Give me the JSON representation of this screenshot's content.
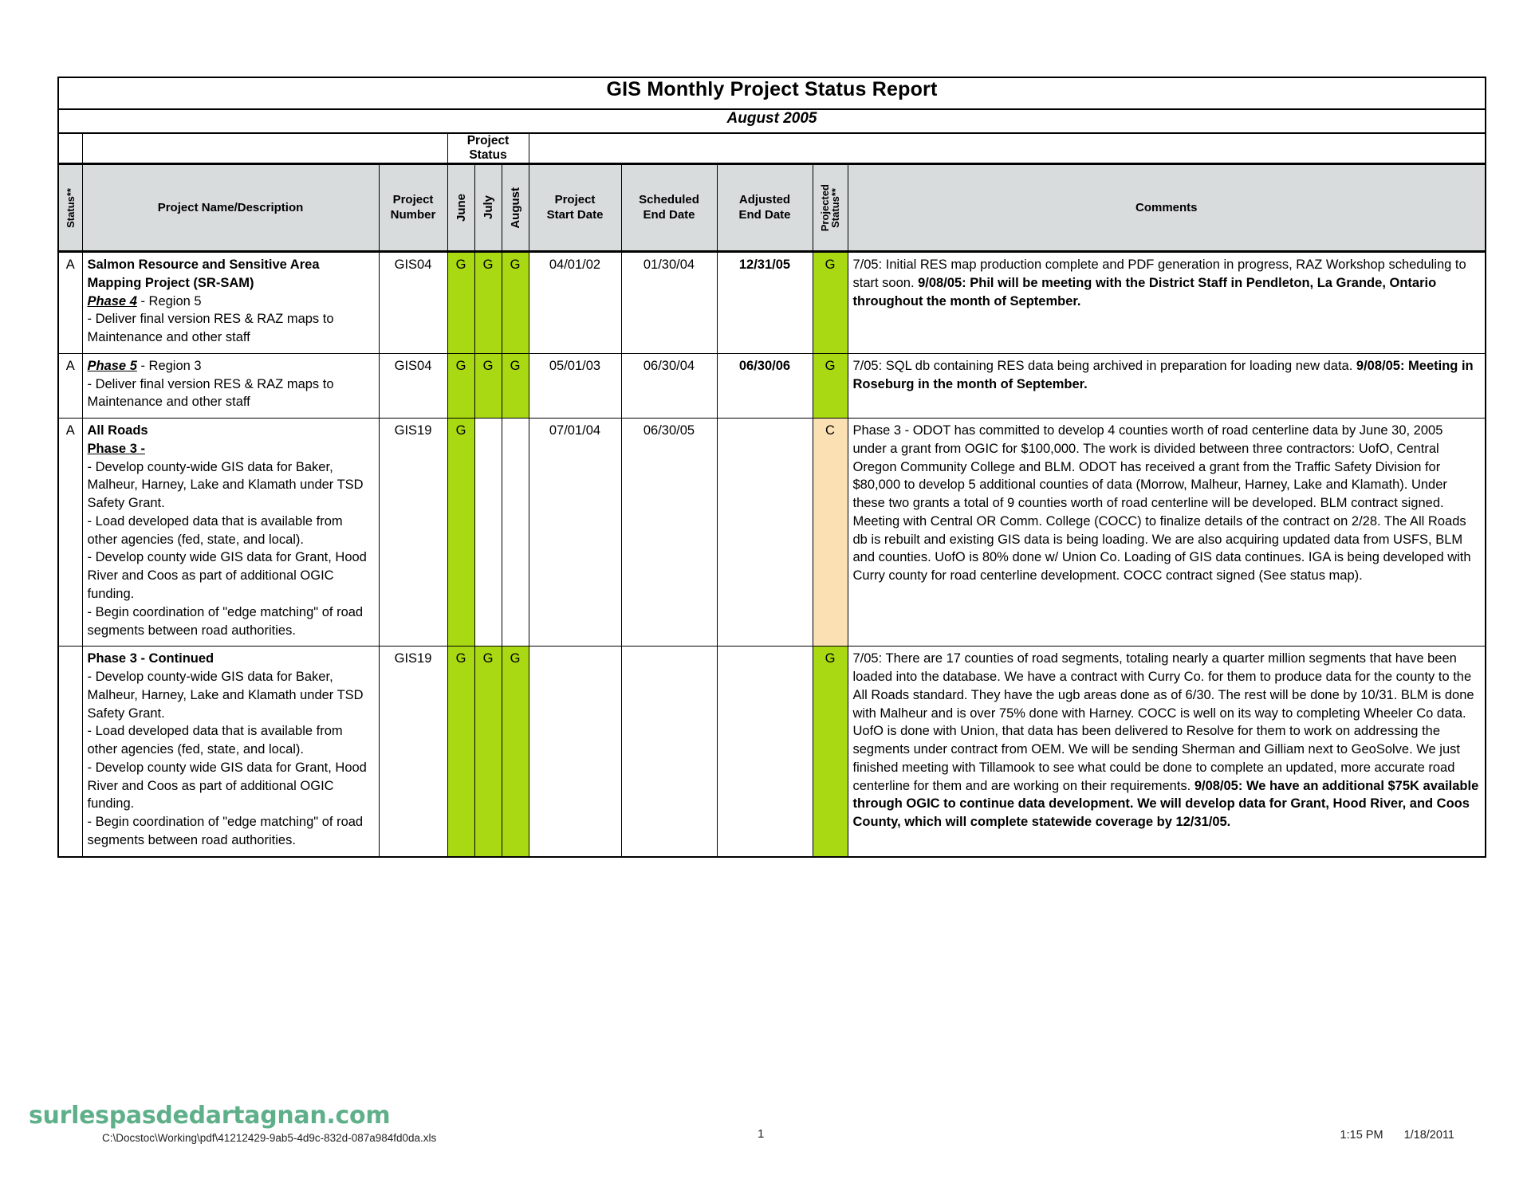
{
  "report": {
    "title": "GIS Monthly Project Status Report",
    "subtitle": "August 2005",
    "group_header": "Project Status",
    "columns": {
      "status": "Status**",
      "project_name": "Project Name/Description",
      "project_number_line1": "Project",
      "project_number_line2": "Number",
      "month1": "June",
      "month2": "July",
      "month3": "August",
      "start_line1": "Project",
      "start_line2": "Start Date",
      "scheduled_line1": "Scheduled",
      "scheduled_line2": "End Date",
      "adjusted_line1": "Adjusted",
      "adjusted_line2": "End Date",
      "projected_line1": "Projected",
      "projected_line2": "Status**",
      "comments": "Comments"
    },
    "rows": [
      {
        "status": "A",
        "name_title": "Salmon Resource and Sensitive Area Mapping Project (SR-SAM)",
        "name_phase": "Phase 4",
        "name_phase_rest": " - Region 5",
        "name_body": " - Deliver final version RES & RAZ maps to Maintenance and other staff",
        "project_number": "GIS04",
        "june": "G",
        "july": "G",
        "august": "G",
        "start_date": "04/01/02",
        "scheduled_end": "01/30/04",
        "adjusted_end": "12/31/05",
        "projected_status": "G",
        "projected_color": "green",
        "comment_plain": "7/05: Initial RES map production complete and PDF generation in progress, RAZ Workshop scheduling to start soon.  ",
        "comment_bold": "9/08/05:  Phil will be meeting with the District Staff in Pendleton, La Grande, Ontario throughout the month of September."
      },
      {
        "status": "A",
        "name_title": "",
        "name_phase": "Phase 5",
        "name_phase_rest": " - Region 3",
        "name_body": " - Deliver final version RES & RAZ maps to Maintenance and other staff",
        "project_number": "GIS04",
        "june": "G",
        "july": "G",
        "august": "G",
        "start_date": "05/01/03",
        "scheduled_end": "06/30/04",
        "adjusted_end": "06/30/06",
        "projected_status": "G",
        "projected_color": "green",
        "comment_plain": "7/05: SQL db containing RES data being archived in preparation for loading new data.  ",
        "comment_bold": "9/08/05:  Meeting in Roseburg in the month of September."
      },
      {
        "status": "A",
        "name_title": "All Roads",
        "name_phase": "Phase 3 -",
        "name_phase_rest": "",
        "name_body": " - Develop county-wide GIS data for Baker, Malheur, Harney, Lake and Klamath under TSD Safety Grant.\n-  Load developed data that is available from other agencies (fed, state, and local).\n -  Develop county wide GIS data for Grant, Hood River and Coos as part of additional OGIC funding.\n -  Begin coordination of \"edge matching\" of road segments between road authorities.",
        "project_number": "GIS19",
        "june": "G",
        "july": "",
        "august": "",
        "start_date": "07/01/04",
        "scheduled_end": "06/30/05",
        "adjusted_end": "",
        "projected_status": "C",
        "projected_color": "amber",
        "comment_plain": "Phase 3 - ODOT has committed to develop 4 counties worth of road centerline data by June 30, 2005 under a grant from OGIC for $100,000.  The work is divided between three contractors: UofO, Central Oregon Community College and BLM.  ODOT has received a grant from the Traffic Safety Division for $80,000 to develop 5 additional counties of data (Morrow, Malheur, Harney, Lake and Klamath).  Under these two grants a total of 9 counties worth of road centerline will be developed.  BLM contract signed. Meeting with Central OR Comm. College (COCC) to finalize details of the contract on 2/28.  The All Roads db is rebuilt and existing GIS data is being loading.  We are also acquiring updated data from USFS, BLM and counties.  UofO is 80% done w/ Union Co.  Loading of GIS data continues.  IGA is being developed with Curry county for road centerline development. COCC contract signed (See status map).",
        "comment_bold": ""
      },
      {
        "status": "",
        "name_title": "Phase 3 - Continued",
        "name_phase": "",
        "name_phase_rest": "",
        "name_body": "- Develop county-wide GIS data for Baker, Malheur, Harney, Lake and Klamath under TSD Safety Grant.\n-  Load developed data that is available from other agencies (fed, state, and local).\n -  Develop county wide GIS data for Grant, Hood River and Coos as part of additional OGIC funding.\n-  Begin coordination of \"edge matching\" of road segments between road authorities.",
        "project_number": "GIS19",
        "june": "G",
        "july": "G",
        "august": "G",
        "start_date": "",
        "scheduled_end": "",
        "adjusted_end": "",
        "projected_status": "G",
        "projected_color": "green",
        "comment_plain": "7/05: There are 17 counties of road segments, totaling nearly a quarter million segments that have been loaded into the database.  We have a contract with Curry Co. for them to produce data for the county to the All Roads standard.  They have the ugb areas done as of 6/30.  The rest will be done by 10/31.  BLM is done with Malheur and is over 75% done with Harney.  COCC is well on its way to completing Wheeler Co data.  UofO is done with Union, that data has been delivered to Resolve for them to work on addressing the segments under contract from OEM.  We will be sending Sherman and Gilliam next to GeoSolve.  We just finished meeting with Tillamook to see what could be done to complete an updated, more accurate road centerline for them and are working on their requirements.  ",
        "comment_bold": "9/08/05: We have an additional $75K available through OGIC to continue data development.  We will develop data for Grant, Hood River, and Coos County, which will complete statewide coverage by 12/31/05."
      }
    ]
  },
  "footer": {
    "watermark": "surlespasdedartagnan.com",
    "file_path": "C:\\Docstoc\\Working\\pdf\\41212429-9ab5-4d9c-832d-087a984fd0da.xls",
    "page_number": "1",
    "time": "1:15 PM",
    "date": "1/18/2011"
  },
  "colors": {
    "status_green": "#a8d912",
    "status_amber": "#fbe0b4",
    "header_gray": "#d8dcdc",
    "watermark_green": "#5fb08a"
  }
}
